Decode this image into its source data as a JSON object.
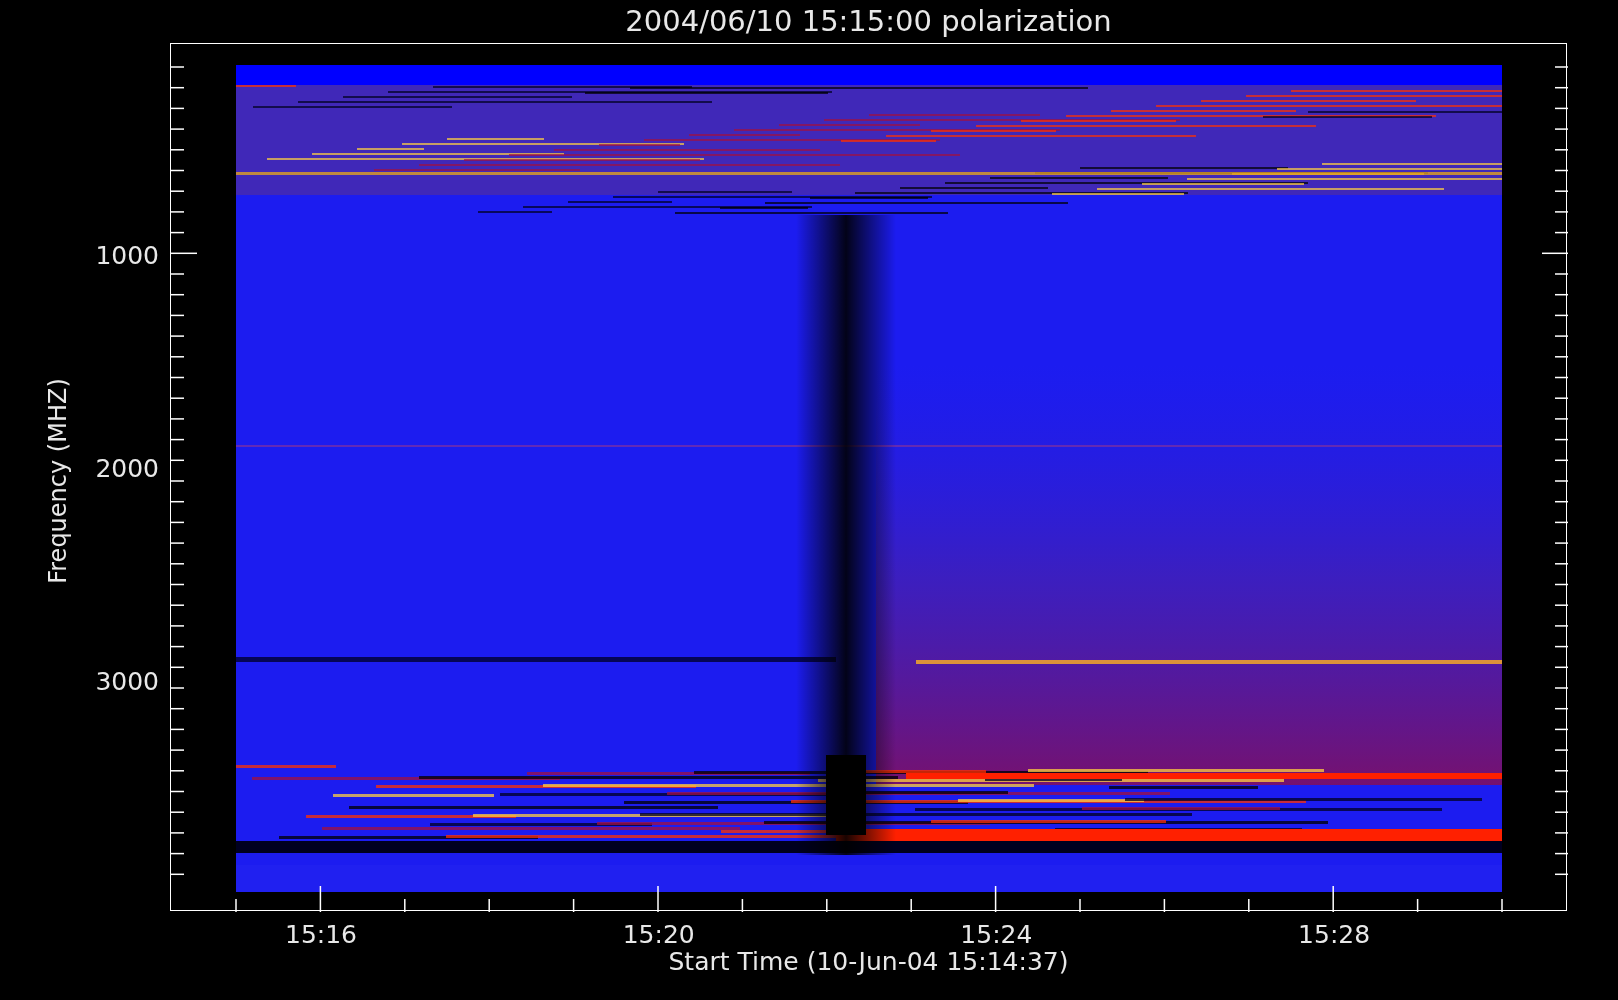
{
  "title": "2004/06/10 15:15:00 polarization",
  "y_axis": {
    "label": "Frequency (MHZ)",
    "ticks": [
      "1000",
      "2000",
      "3000"
    ]
  },
  "x_axis": {
    "label": "Start Time (10-Jun-04 15:14:37)",
    "ticks": [
      "15:16",
      "15:20",
      "15:24",
      "15:28"
    ]
  }
}
